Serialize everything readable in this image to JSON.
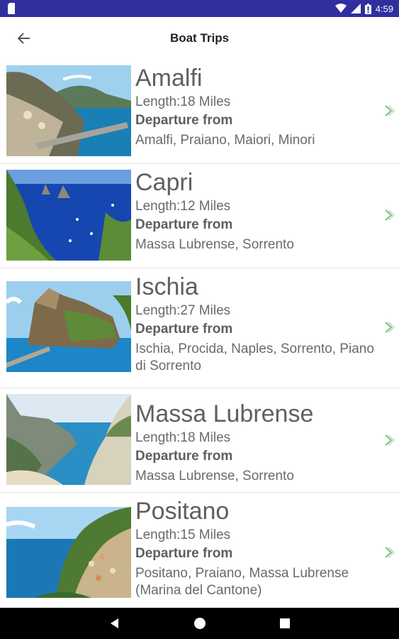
{
  "status_bar": {
    "time": "4:59",
    "icons": [
      "sd-card-icon",
      "wifi-icon",
      "cell-signal-icon",
      "battery-icon"
    ]
  },
  "app_bar": {
    "title": "Boat Trips",
    "back_icon": "arrow-left-icon"
  },
  "trips": [
    {
      "title": "Amalfi",
      "length": "Length:18 Miles",
      "departure_label": "Departure from",
      "departure": "Amalfi, Praiano, Maiori, Minori",
      "chevron_icon": "chevron-right-icon"
    },
    {
      "title": "Capri",
      "length": "Length:12 Miles",
      "departure_label": "Departure from",
      "departure": "Massa Lubrense, Sorrento",
      "chevron_icon": "chevron-right-icon"
    },
    {
      "title": "Ischia",
      "length": "Length:27 Miles",
      "departure_label": "Departure from",
      "departure": "Ischia, Procida, Naples, Sorrento, Piano di Sorrento",
      "chevron_icon": "chevron-right-icon"
    },
    {
      "title": "Massa Lubrense",
      "length": "Length:18 Miles",
      "departure_label": "Departure from",
      "departure": "Massa Lubrense, Sorrento",
      "chevron_icon": "chevron-right-icon"
    },
    {
      "title": "Positano",
      "length": "Length:15 Miles",
      "departure_label": "Departure from",
      "departure": "Positano, Praiano, Massa Lubrense (Marina del Cantone)",
      "chevron_icon": "chevron-right-icon"
    }
  ],
  "colors": {
    "status_bar": "#2f2fa0",
    "chevron": "#7bbf7b",
    "text": "#666666",
    "title_text": "#5f5f5f"
  },
  "nav_bar": {
    "buttons": [
      "back-triangle-icon",
      "home-circle-icon",
      "recents-square-icon"
    ]
  }
}
